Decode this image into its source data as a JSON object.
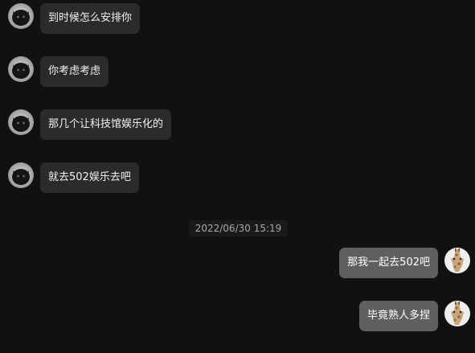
{
  "messages_incoming": [
    {
      "text": "到时候怎么安排你"
    },
    {
      "text": "你考虑考虑"
    },
    {
      "text": "那几个让科技馆娱乐化的"
    },
    {
      "text": "就去502娱乐去吧"
    }
  ],
  "divider": {
    "timestamp": "2022/06/30 15:19"
  },
  "messages_outgoing": [
    {
      "text": "那我一起去502吧"
    },
    {
      "text": "毕竟熟人多捏"
    }
  ],
  "avatars": {
    "contact": "cat-avatar-icon",
    "self": "giraffe-avatar-icon"
  },
  "colors": {
    "background": "#111111",
    "incoming_bubble": "#2b2b2b",
    "outgoing_bubble": "#5f5f5f",
    "timestamp_text": "#a8a8a8"
  }
}
